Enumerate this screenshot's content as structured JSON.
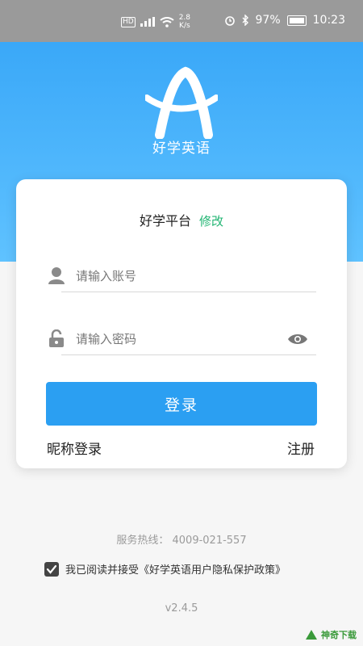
{
  "status_bar": {
    "hd": "HD",
    "signal": "4G",
    "net_speed_value": "2.8",
    "net_speed_unit": "K/s",
    "battery": "97%",
    "time": "10:23"
  },
  "hero": {
    "app_name": "好学英语"
  },
  "card": {
    "platform_name": "好学平台",
    "platform_edit": "修改",
    "account_placeholder": "请输入账号",
    "password_placeholder": "请输入密码",
    "login_label": "登录",
    "nickname_login": "昵称登录",
    "register": "注册"
  },
  "footer": {
    "hotline": "服务热线：  4009-021-557",
    "agreement": "我已阅读并接受《好学英语用户隐私保护政策》",
    "version": "v2.4.5"
  },
  "watermark": {
    "text": "神奇下载"
  },
  "colors": {
    "primary": "#2b9ff2",
    "edit_green": "#22b573"
  }
}
